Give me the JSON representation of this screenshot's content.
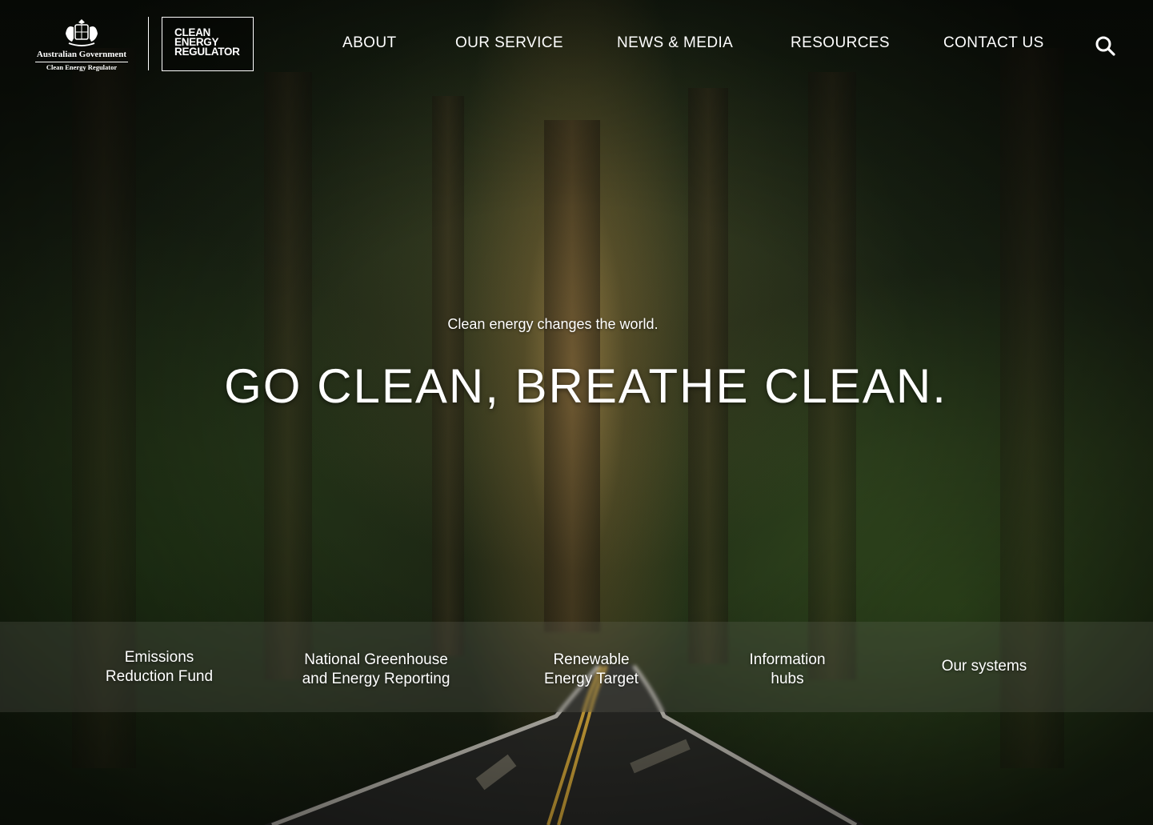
{
  "branding": {
    "gov_line1": "Australian Government",
    "gov_line2": "Clean Energy Regulator",
    "cer_line1": "CLEAN",
    "cer_line2": "ENERGY",
    "cer_line3": "REGULATOR"
  },
  "nav": {
    "items": [
      {
        "label": "ABOUT"
      },
      {
        "label": "OUR SERVICE"
      },
      {
        "label": "NEWS & MEDIA"
      },
      {
        "label": "RESOURCES"
      },
      {
        "label": "CONTACT US"
      }
    ],
    "search_icon": "search-icon"
  },
  "hero": {
    "tagline": "Clean energy changes the world.",
    "headline": "GO CLEAN, BREATHE CLEAN."
  },
  "programs": [
    {
      "line1": "Emissions",
      "line2": "Reduction Fund"
    },
    {
      "line1": "National Greenhouse",
      "line2": "and Energy Reporting"
    },
    {
      "line1": "Renewable",
      "line2": "Energy Target"
    },
    {
      "line1": "Information",
      "line2": "hubs"
    },
    {
      "line1": "Our systems",
      "line2": ""
    }
  ],
  "colors": {
    "text": "#ffffff",
    "road_line": "#d6a93a",
    "forest_dark": "#1a2414"
  }
}
